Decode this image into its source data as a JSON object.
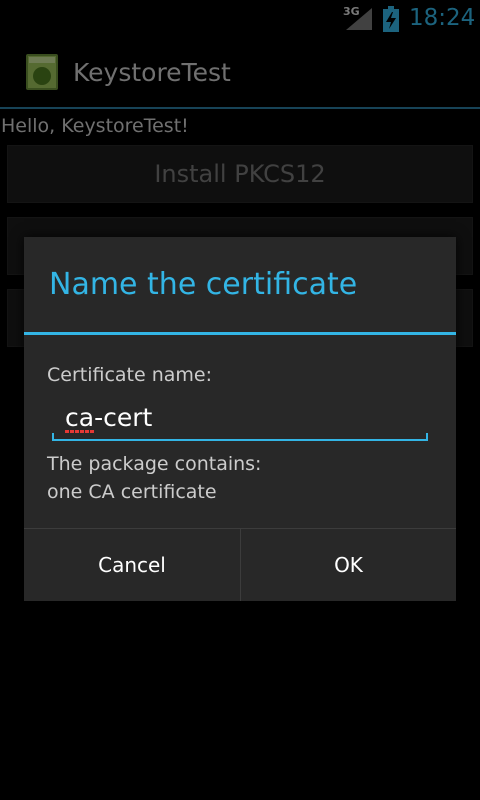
{
  "status_bar": {
    "network": "3G",
    "time": "18:24",
    "signal_icon": "signal-icon",
    "battery_icon": "battery-charging-icon"
  },
  "action_bar": {
    "app_icon": "android-app-icon",
    "title": "KeystoreTest"
  },
  "main": {
    "hello_text": "Hello, KeystoreTest!",
    "buttons": [
      {
        "label": "Install PKCS12"
      },
      {
        "label": ""
      },
      {
        "label": ""
      }
    ]
  },
  "dialog": {
    "title": "Name the certificate",
    "field_label": "Certificate name:",
    "field_value": "ca-cert",
    "message_lines": [
      "The package contains:",
      "one CA certificate"
    ],
    "cancel_label": "Cancel",
    "ok_label": "OK"
  },
  "colors": {
    "accent": "#33b5e5",
    "background": "#000000",
    "dialog_background": "#282828"
  }
}
